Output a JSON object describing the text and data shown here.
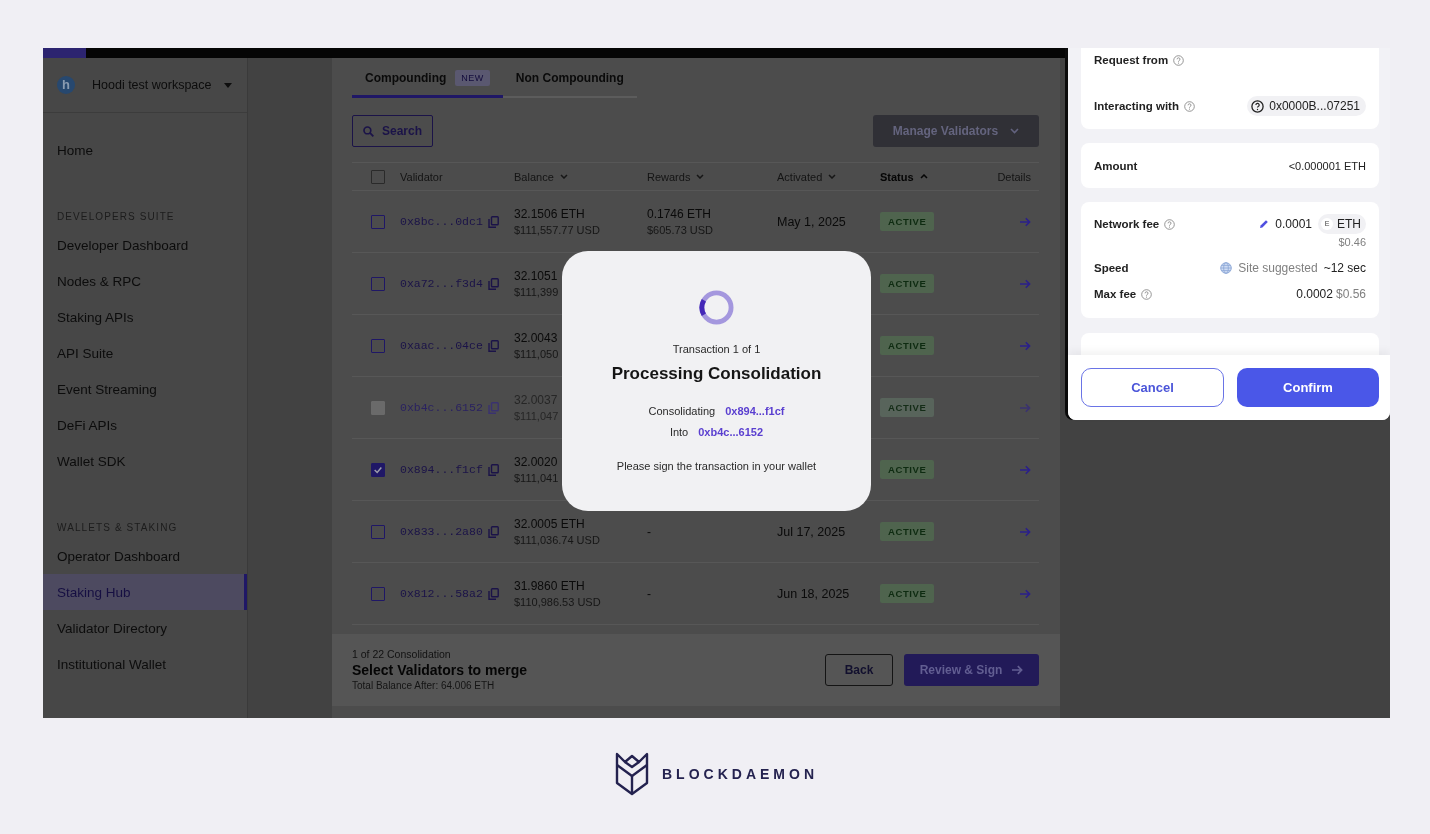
{
  "sidebar": {
    "workspace": {
      "logo_letter": "h",
      "name": "Hoodi test workspace"
    },
    "sections": [
      {
        "items": [
          {
            "label": "Home",
            "selected": false
          }
        ]
      },
      {
        "title": "DEVELOPERS SUITE",
        "items": [
          {
            "label": "Developer Dashboard",
            "selected": false
          },
          {
            "label": "Nodes & RPC",
            "selected": false
          },
          {
            "label": "Staking APIs",
            "selected": false
          },
          {
            "label": "API Suite",
            "selected": false
          },
          {
            "label": "Event Streaming",
            "selected": false
          },
          {
            "label": "DeFi APIs",
            "selected": false
          },
          {
            "label": "Wallet SDK",
            "selected": false
          }
        ]
      },
      {
        "title": "WALLETS & STAKING",
        "items": [
          {
            "label": "Operator Dashboard",
            "selected": false
          },
          {
            "label": "Staking Hub",
            "selected": true
          },
          {
            "label": "Validator Directory",
            "selected": false
          },
          {
            "label": "Institutional Wallet",
            "selected": false
          }
        ]
      }
    ]
  },
  "tabs": [
    {
      "label": "Compounding",
      "badge": "NEW",
      "selected": true
    },
    {
      "label": "Non Compounding",
      "selected": false
    }
  ],
  "toolbar": {
    "search": "Search",
    "manage": "Manage Validators"
  },
  "table": {
    "select_all": {
      "checked": false
    },
    "columns": [
      {
        "label": "Validator",
        "sortable": false,
        "sorted": false
      },
      {
        "label": "Balance",
        "sortable": true,
        "sorted": false
      },
      {
        "label": "Rewards",
        "sortable": true,
        "sorted": false
      },
      {
        "label": "Activated",
        "sortable": true,
        "sorted": false
      },
      {
        "label": "Status",
        "sortable": true,
        "sorted": true
      },
      {
        "label": "Details",
        "sortable": false,
        "sorted": false
      }
    ],
    "rows": [
      {
        "address": "0x8bc...0dc1",
        "checked": false,
        "disabled": false,
        "balance_eth": "32.1506 ETH",
        "balance_usd": "$111,557.77 USD",
        "rewards_eth": "0.1746 ETH",
        "rewards_usd": "$605.73 USD",
        "activated": "May 1, 2025",
        "status": "ACTIVE"
      },
      {
        "address": "0xa72...f3d4",
        "checked": false,
        "disabled": false,
        "balance_eth": "32.1051",
        "balance_usd": "$111,399",
        "status": "ACTIVE"
      },
      {
        "address": "0xaac...04ce",
        "checked": false,
        "disabled": false,
        "balance_eth": "32.0043",
        "balance_usd": "$111,050",
        "status": "ACTIVE"
      },
      {
        "address": "0xb4c...6152",
        "checked": false,
        "disabled": true,
        "balance_eth": "32.0037",
        "balance_usd": "$111,047",
        "status": "ACTIVE"
      },
      {
        "address": "0x894...f1cf",
        "checked": true,
        "disabled": false,
        "balance_eth": "32.0020",
        "balance_usd": "$111,041",
        "status": "ACTIVE"
      },
      {
        "address": "0x833...2a80",
        "checked": false,
        "disabled": false,
        "balance_eth": "32.0005 ETH",
        "balance_usd": "$111,036.74 USD",
        "rewards_eth": "-",
        "activated": "Jul 17, 2025",
        "status": "ACTIVE"
      },
      {
        "address": "0x812...58a2",
        "checked": false,
        "disabled": false,
        "balance_eth": "31.9860 ETH",
        "balance_usd": "$110,986.53 USD",
        "rewards_eth": "-",
        "activated": "Jun 18, 2025",
        "status": "ACTIVE"
      }
    ]
  },
  "footer": {
    "step": "1 of 22 Consolidation",
    "title": "Select Validators to merge",
    "total": "Total Balance After: 64.006 ETH",
    "buttons": [
      {
        "label": "Back",
        "kind": "secondary"
      },
      {
        "label": "Review & Sign",
        "kind": "primary"
      }
    ]
  },
  "modal": {
    "counter": "Transaction 1 of 1",
    "title": "Processing Consolidation",
    "details": [
      {
        "label": "Consolidating",
        "value": "0x894...f1cf"
      },
      {
        "label": "Into",
        "value": "0xb4c...6152"
      }
    ],
    "message": "Please sign the transaction in your wallet"
  },
  "wallet": {
    "request_from": {
      "label": "Request from",
      "help": true
    },
    "interacting_with": {
      "label": "Interacting with",
      "help": true,
      "address": "0x0000B...07251"
    },
    "amount": {
      "label": "Amount",
      "help": false,
      "value": "<0.000001 ETH"
    },
    "network_fee": {
      "label": "Network fee",
      "help": true,
      "value": "0.0001",
      "token_letter": "E",
      "token": "ETH",
      "fiat": "$0.46"
    },
    "speed": {
      "label": "Speed",
      "help": false,
      "source": "Site suggested",
      "time": "~12 sec"
    },
    "max_fee": {
      "label": "Max fee",
      "help": true,
      "value": "0.0002",
      "fiat": "$0.56"
    },
    "buttons": [
      {
        "label": "Cancel",
        "kind": "secondary"
      },
      {
        "label": "Confirm",
        "kind": "primary"
      }
    ]
  },
  "brand": {
    "name": "BLOCKDAEMON"
  }
}
